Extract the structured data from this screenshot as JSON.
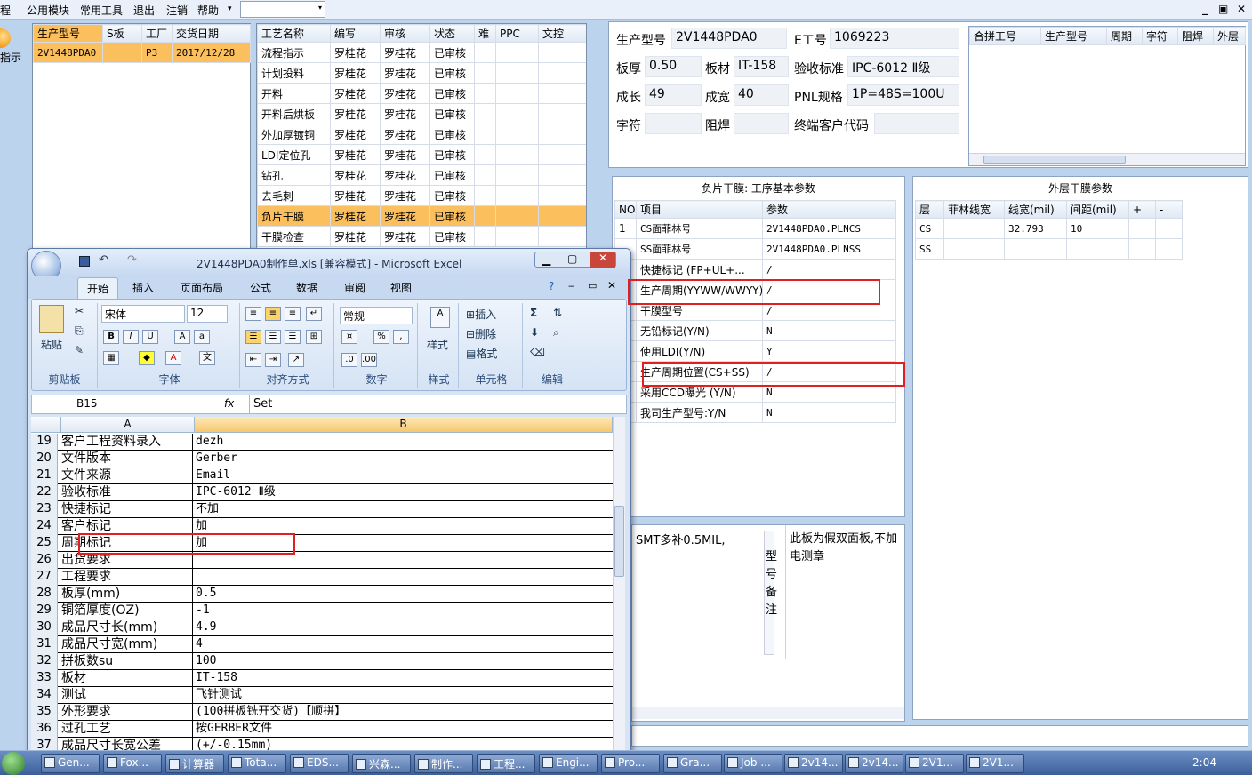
{
  "menu": {
    "items": [
      "程",
      "公用模块",
      "常用工具",
      "退出",
      "注销",
      "帮助"
    ],
    "help_arrow": "▾",
    "combo_arrow": "▾",
    "win_min": "_",
    "win_max": "▣",
    "win_close": "✕"
  },
  "left_button": {
    "label": "指示"
  },
  "order_table": {
    "headers": [
      "生产型号",
      "S板",
      "工厂",
      "交货日期"
    ],
    "rows": [
      [
        "2V1448PDA0",
        "",
        "P3",
        "2017/12/28"
      ]
    ]
  },
  "process_table": {
    "headers": [
      "工艺名称",
      "编写",
      "审核",
      "状态",
      "难",
      "PPC",
      "文控"
    ],
    "rows": [
      [
        "流程指示",
        "罗桂花",
        "罗桂花",
        "已审核"
      ],
      [
        "计划投料",
        "罗桂花",
        "罗桂花",
        "已审核"
      ],
      [
        "开料",
        "罗桂花",
        "罗桂花",
        "已审核"
      ],
      [
        "开料后烘板",
        "罗桂花",
        "罗桂花",
        "已审核"
      ],
      [
        "外加厚镀铜",
        "罗桂花",
        "罗桂花",
        "已审核"
      ],
      [
        "LDI定位孔",
        "罗桂花",
        "罗桂花",
        "已审核"
      ],
      [
        "钻孔",
        "罗桂花",
        "罗桂花",
        "已审核"
      ],
      [
        "去毛刺",
        "罗桂花",
        "罗桂花",
        "已审核"
      ],
      [
        "负片干膜",
        "罗桂花",
        "罗桂花",
        "已审核"
      ],
      [
        "干膜检查",
        "罗桂花",
        "罗桂花",
        "已审核"
      ]
    ],
    "selected_index": 8
  },
  "info": {
    "model_label": "生产型号",
    "model_value": "2V1448PDA0",
    "eno_label": "E工号",
    "eno_value": "1069223",
    "thick_label": "板厚",
    "thick_value": "0.50",
    "mat_label": "板材",
    "mat_value": "IT-158",
    "std_label": "验收标准",
    "std_value": "IPC-6012 Ⅱ级",
    "len_label": "成长",
    "len_value": "49",
    "wid_label": "成宽",
    "wid_value": "40",
    "pnl_label": "PNL规格",
    "pnl_value": "1P=48S=100U",
    "char_label": "字符",
    "char_value": "",
    "mask_label": "阻焊",
    "mask_value": "",
    "cust_label": "终端客户代码",
    "cust_value": ""
  },
  "merge_table": {
    "headers": [
      "合拼工号",
      "生产型号",
      "周期",
      "字符",
      "阻焊",
      "外层"
    ]
  },
  "params": {
    "title": "负片干膜: 工序基本参数",
    "headers": [
      "NO",
      "项目",
      "参数"
    ],
    "rows": [
      [
        "1",
        "CS面菲林号",
        "2V1448PDA0.PLNCS"
      ],
      [
        "",
        "SS面菲林号",
        "2V1448PDA0.PLNSS"
      ],
      [
        "",
        "快捷标记 (FP+UL+...",
        "/"
      ],
      [
        "",
        "生产周期(YYWW/WWYY)",
        "/"
      ],
      [
        "",
        "干膜型号",
        "/"
      ],
      [
        "",
        "无铅标记(Y/N)",
        "N"
      ],
      [
        "",
        "使用LDI(Y/N)",
        "Y"
      ],
      [
        "",
        "生产周期位置(CS+SS)",
        "/"
      ],
      [
        "",
        "采用CCD曝光 (Y/N)",
        "N"
      ],
      [
        "",
        "我司生产型号:Y/N",
        "N"
      ]
    ]
  },
  "outer": {
    "title": "外层干膜参数",
    "headers": [
      "层",
      "菲林线宽",
      "线宽(mil)",
      "间距(mil)",
      "+",
      "-"
    ],
    "rows": [
      [
        "CS",
        "",
        "32.793",
        "10",
        "",
        ""
      ],
      [
        "SS",
        "",
        "",
        "",
        "",
        ""
      ]
    ]
  },
  "notes": {
    "left_note": "SMT多补0.5MIL,",
    "side_label": "型号备注",
    "right_note": "此板为假双面板,不加电测章"
  },
  "excel": {
    "title": "2V1448PDA0制作单.xls [兼容模式] - Microsoft Excel",
    "tabs": [
      "开始",
      "插入",
      "页面布局",
      "公式",
      "数据",
      "审阅",
      "视图"
    ],
    "font_name": "宋体",
    "font_size": "12",
    "number_format": "常规",
    "group_labels": [
      "剪贴板",
      "字体",
      "对齐方式",
      "数字",
      "样式",
      "单元格",
      "编辑"
    ],
    "paste_label": "粘贴",
    "style_label": "样式",
    "insert_label": "插入",
    "delete_label": "删除",
    "format_label": "格式",
    "cell_ref": "B15",
    "fx": "fx",
    "formula": "Set",
    "col_a": "A",
    "col_b": "B",
    "rows": [
      [
        "19",
        "客户工程资料录入",
        "dezh"
      ],
      [
        "20",
        "文件版本",
        "Gerber"
      ],
      [
        "21",
        "文件来源",
        "Email"
      ],
      [
        "22",
        "验收标准",
        "IPC-6012 Ⅱ级"
      ],
      [
        "23",
        "快捷标记",
        "不加"
      ],
      [
        "24",
        "客户标记",
        "加"
      ],
      [
        "25",
        "周期标记",
        "加"
      ],
      [
        "26",
        "出货要求",
        ""
      ],
      [
        "27",
        "工程要求",
        ""
      ],
      [
        "28",
        "板厚(mm)",
        "0.5"
      ],
      [
        "29",
        "铜箔厚度(OZ)",
        "-1"
      ],
      [
        "30",
        "成品尺寸长(mm)",
        "4.9"
      ],
      [
        "31",
        "成品尺寸宽(mm)",
        "4"
      ],
      [
        "32",
        "拼板数su",
        "100"
      ],
      [
        "33",
        "板材",
        "IT-158"
      ],
      [
        "34",
        "测试",
        "飞针测试"
      ],
      [
        "35",
        "外形要求",
        "(100拼板铣开交货)【顺拼】"
      ],
      [
        "36",
        "过孔工艺",
        "按GERBER文件"
      ],
      [
        "37",
        "成品尺寸长宽公差",
        "(+/-0.15mm)"
      ]
    ]
  },
  "taskbar": {
    "items": [
      "Gen...",
      "Fox...",
      "计算器",
      "Tota...",
      "EDS...",
      "兴森...",
      "制作...",
      "工程...",
      "Engi...",
      "Pro...",
      "Gra...",
      "Job ...",
      "2v14...",
      "2v14...",
      "2V1...",
      "2V1..."
    ],
    "clock": "2:04"
  }
}
